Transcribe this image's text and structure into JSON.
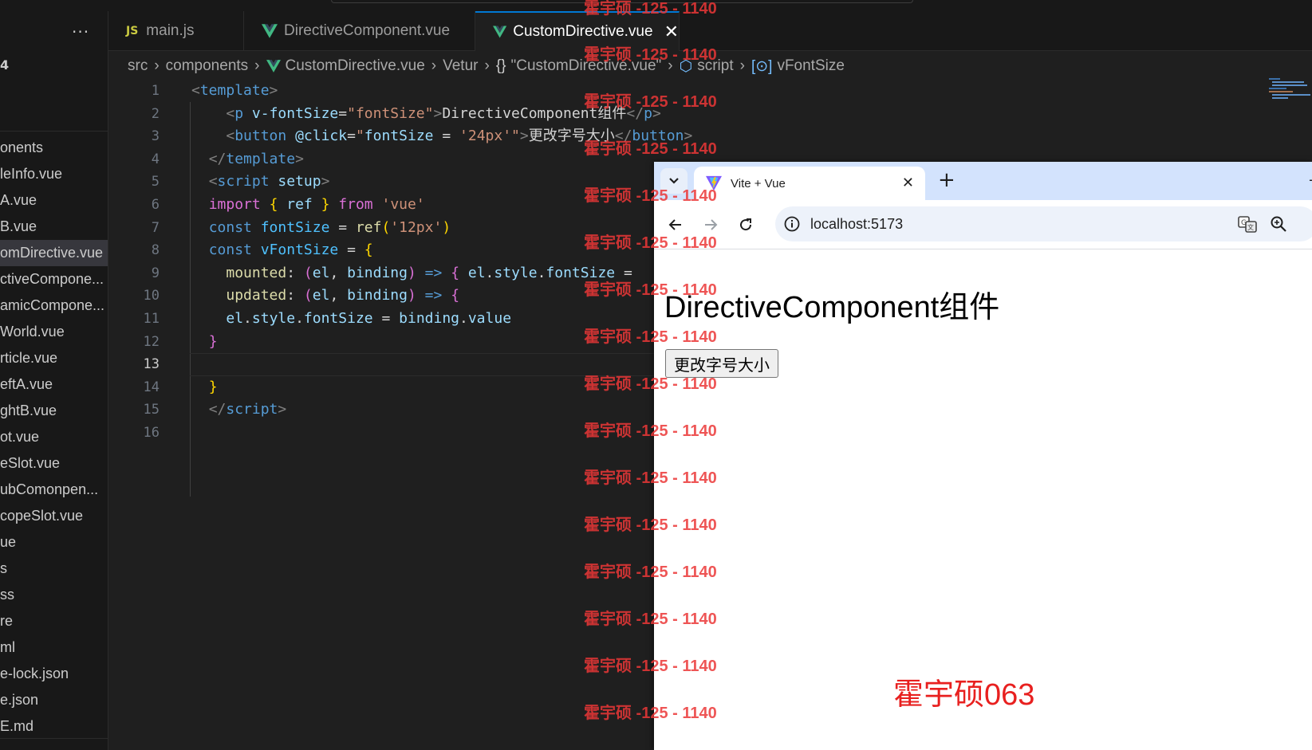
{
  "sidebar": {
    "more_label": "···",
    "section_digit": "4",
    "files": [
      "onents",
      "leInfo.vue",
      "A.vue",
      "B.vue",
      "omDirective.vue",
      "ctiveCompone...",
      "amicCompone...",
      "World.vue",
      "rticle.vue",
      "eftA.vue",
      "ghtB.vue",
      "ot.vue",
      "eSlot.vue",
      "ubComonpen...",
      "copeSlot.vue",
      "ue",
      "s",
      "ss",
      "re",
      "ml",
      "e-lock.json",
      "e.json",
      "E.md"
    ],
    "active_index": 4
  },
  "tabs": [
    {
      "icon": "JS",
      "label": "main.js"
    },
    {
      "icon": "vue",
      "label": "DirectiveComponent.vue"
    },
    {
      "icon": "vue",
      "label": "CustomDirective.vue",
      "close": "✕"
    }
  ],
  "breadcrumb": {
    "src": "src",
    "components": "components",
    "file": "CustomDirective.vue",
    "vetur": "Vetur",
    "braces": "{}",
    "object": "\"CustomDirective.vue\"",
    "script": "script",
    "symbol": "vFontSize"
  },
  "editor": {
    "line_numbers": [
      "1",
      "2",
      "3",
      "4",
      "5",
      "6",
      "7",
      "8",
      "9",
      "10",
      "11",
      "12",
      "13",
      "14",
      "15",
      "16"
    ],
    "current_line": 13
  },
  "code": {
    "l1": {
      "lt": "<",
      "tag": "template",
      "gt": ">"
    },
    "l2": {
      "lt": "<",
      "tag": "p",
      "attr": "v-fontSize",
      "eq": "=",
      "val": "\"fontSize\"",
      "gt": ">",
      "text": "DirectiveComponent组件",
      "close_lt": "</",
      "close_tag": "p",
      "close_gt": ">"
    },
    "l3": {
      "lt": "<",
      "tag": "button",
      "attr": "@click",
      "eq": "=",
      "q1": "\"",
      "expr": "fontSize",
      "op": " = ",
      "str": "'24px'",
      "q2": "\"",
      "gt": ">",
      "text": "更改字号大小",
      "close_lt": "</",
      "close_tag": "button",
      "close_gt": ">"
    },
    "l4": {
      "lt": "</",
      "tag": "template",
      "gt": ">"
    },
    "l5": {
      "lt": "<",
      "tag": "script",
      "attr": "setup",
      "gt": ">"
    },
    "l6": {
      "kw": "import",
      "b1": "{",
      "name": "ref",
      "b2": "}",
      "from": "from",
      "str": "'vue'"
    },
    "l7": {
      "kw": "const",
      "name": "fontSize",
      "eq": " = ",
      "fn": "ref",
      "p1": "(",
      "str": "'12px'",
      "p2": ")"
    },
    "l8": {
      "kw": "const",
      "name": "vFontSize",
      "eq": " = ",
      "b": "{"
    },
    "l9": {
      "fn": "mounted",
      "colon": ": ",
      "p1": "(",
      "a1": "el",
      "comma": ", ",
      "a2": "binding",
      "p2": ")",
      "arrow": " => ",
      "b": "{",
      "obj": " el",
      "dot1": ".",
      "prop1": "style",
      "dot2": ".",
      "prop2": "fontSize",
      "rest": " ="
    },
    "l10": {
      "fn": "updated",
      "colon": ": ",
      "p1": "(",
      "a1": "el",
      "comma": ", ",
      "a2": "binding",
      "p2": ")",
      "arrow": " => ",
      "b": "{"
    },
    "l11": {
      "obj": "el",
      "dot1": ".",
      "prop1": "style",
      "dot2": ".",
      "prop2": "fontSize",
      "eq": " = ",
      "obj2": "binding",
      "dot3": ".",
      "prop3": "value"
    },
    "l12": {
      "b": "}"
    },
    "l14": {
      "b": "}"
    },
    "l15": {
      "lt": "</",
      "tag": "script",
      "gt": ">"
    }
  },
  "browser": {
    "tab_title": "Vite + Vue",
    "tab_close": "✕",
    "new_tab": "+",
    "minimize": "–",
    "url": "localhost:5173",
    "heading": "DirectiveComponent组件",
    "button_label": "更改字号大小"
  },
  "watermark": {
    "repeated": "霍宇硕 -125 - 1140",
    "signature": "霍宇硕063"
  },
  "colors": {
    "editor_bg": "#1f1f1f",
    "accent": "#0078d4",
    "vue_green": "#41b883",
    "watermark_red": "#eb3737"
  }
}
